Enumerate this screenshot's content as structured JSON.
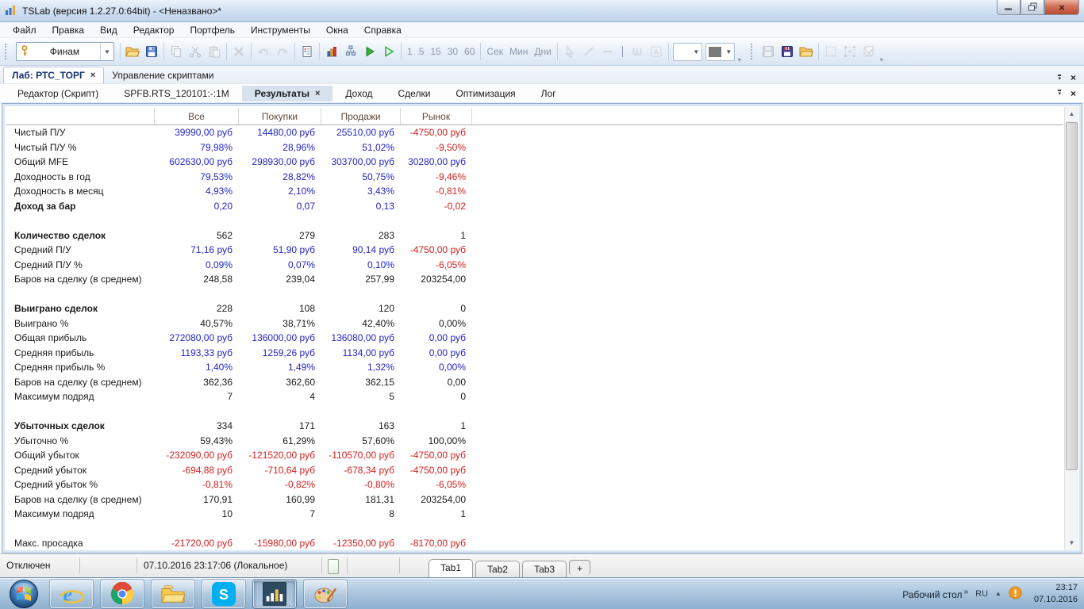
{
  "window": {
    "title": "TSLab (версия 1.2.27.0:64bit) - <Неназвано>*"
  },
  "menu": {
    "items": [
      "Файл",
      "Правка",
      "Вид",
      "Редактор",
      "Портфель",
      "Инструменты",
      "Окна",
      "Справка"
    ]
  },
  "toolbar": {
    "account_selector": "Финам",
    "timeframes": [
      "1",
      "5",
      "15",
      "30",
      "60"
    ],
    "periods": [
      "Сек",
      "Мин",
      "Дни"
    ]
  },
  "doc_tabs": [
    {
      "label": "Лаб: РТС_ТОРГ",
      "active": true,
      "closable": true
    },
    {
      "label": "Управление скриптами",
      "active": false,
      "closable": false
    }
  ],
  "view_tabs": [
    {
      "label": "Редактор (Скрипт)",
      "active": false,
      "closable": false
    },
    {
      "label": "SPFB.RTS_120101:-:1M",
      "active": false,
      "closable": false
    },
    {
      "label": "Результаты",
      "active": true,
      "closable": true
    },
    {
      "label": "Доход",
      "active": false,
      "closable": false
    },
    {
      "label": "Сделки",
      "active": false,
      "closable": false
    },
    {
      "label": "Оптимизация",
      "active": false,
      "closable": false
    },
    {
      "label": "Лог",
      "active": false,
      "closable": false
    }
  ],
  "results_table": {
    "columns": [
      "Все",
      "Покупки",
      "Продажи",
      "Рынок"
    ],
    "rows": [
      {
        "label": "Чистый П/У",
        "bold": false,
        "cells": [
          {
            "t": "39990,00 руб",
            "c": "pos"
          },
          {
            "t": "14480,00 руб",
            "c": "pos"
          },
          {
            "t": "25510,00 руб",
            "c": "pos"
          },
          {
            "t": "-4750,00 руб",
            "c": "neg"
          }
        ]
      },
      {
        "label": "Чистый П/У %",
        "bold": false,
        "cells": [
          {
            "t": "79,98%",
            "c": "pos"
          },
          {
            "t": "28,96%",
            "c": "pos"
          },
          {
            "t": "51,02%",
            "c": "pos"
          },
          {
            "t": "-9,50%",
            "c": "neg"
          }
        ]
      },
      {
        "label": "Общий MFE",
        "bold": false,
        "cells": [
          {
            "t": "602630,00 руб",
            "c": "pos"
          },
          {
            "t": "298930,00 руб",
            "c": "pos"
          },
          {
            "t": "303700,00 руб",
            "c": "pos"
          },
          {
            "t": "30280,00 руб",
            "c": "pos"
          }
        ]
      },
      {
        "label": "Доходность в год",
        "bold": false,
        "cells": [
          {
            "t": "79,53%",
            "c": "pos"
          },
          {
            "t": "28,82%",
            "c": "pos"
          },
          {
            "t": "50,75%",
            "c": "pos"
          },
          {
            "t": "-9,46%",
            "c": "neg"
          }
        ]
      },
      {
        "label": "Доходность в месяц",
        "bold": false,
        "cells": [
          {
            "t": "4,93%",
            "c": "pos"
          },
          {
            "t": "2,10%",
            "c": "pos"
          },
          {
            "t": "3,43%",
            "c": "pos"
          },
          {
            "t": "-0,81%",
            "c": "neg"
          }
        ]
      },
      {
        "label": "Доход за бар",
        "bold": true,
        "cells": [
          {
            "t": "0,20",
            "c": "pos"
          },
          {
            "t": "0,07",
            "c": "pos"
          },
          {
            "t": "0,13",
            "c": "pos"
          },
          {
            "t": "-0,02",
            "c": "neg"
          }
        ]
      },
      {
        "spacer": true
      },
      {
        "label": "Количество сделок",
        "bold": true,
        "cells": [
          {
            "t": "562",
            "c": "neu"
          },
          {
            "t": "279",
            "c": "neu"
          },
          {
            "t": "283",
            "c": "neu"
          },
          {
            "t": "1",
            "c": "neu"
          }
        ]
      },
      {
        "label": "Средний П/У",
        "bold": false,
        "cells": [
          {
            "t": "71,16 руб",
            "c": "pos"
          },
          {
            "t": "51,90 руб",
            "c": "pos"
          },
          {
            "t": "90,14 руб",
            "c": "pos"
          },
          {
            "t": "-4750,00 руб",
            "c": "neg"
          }
        ]
      },
      {
        "label": "Средний П/У %",
        "bold": false,
        "cells": [
          {
            "t": "0,09%",
            "c": "pos"
          },
          {
            "t": "0,07%",
            "c": "pos"
          },
          {
            "t": "0,10%",
            "c": "pos"
          },
          {
            "t": "-6,05%",
            "c": "neg"
          }
        ]
      },
      {
        "label": "Баров на сделку (в среднем)",
        "bold": false,
        "cells": [
          {
            "t": "248,58",
            "c": "neu"
          },
          {
            "t": "239,04",
            "c": "neu"
          },
          {
            "t": "257,99",
            "c": "neu"
          },
          {
            "t": "203254,00",
            "c": "neu"
          }
        ]
      },
      {
        "spacer": true
      },
      {
        "label": "Выиграно сделок",
        "bold": true,
        "cells": [
          {
            "t": "228",
            "c": "neu"
          },
          {
            "t": "108",
            "c": "neu"
          },
          {
            "t": "120",
            "c": "neu"
          },
          {
            "t": "0",
            "c": "neu"
          }
        ]
      },
      {
        "label": "Выиграно %",
        "bold": false,
        "cells": [
          {
            "t": "40,57%",
            "c": "neu"
          },
          {
            "t": "38,71%",
            "c": "neu"
          },
          {
            "t": "42,40%",
            "c": "neu"
          },
          {
            "t": "0,00%",
            "c": "neu"
          }
        ]
      },
      {
        "label": "Общая прибыль",
        "bold": false,
        "cells": [
          {
            "t": "272080,00 руб",
            "c": "pos"
          },
          {
            "t": "136000,00 руб",
            "c": "pos"
          },
          {
            "t": "136080,00 руб",
            "c": "pos"
          },
          {
            "t": "0,00 руб",
            "c": "pos"
          }
        ]
      },
      {
        "label": "Средняя прибыль",
        "bold": false,
        "cells": [
          {
            "t": "1193,33 руб",
            "c": "pos"
          },
          {
            "t": "1259,26 руб",
            "c": "pos"
          },
          {
            "t": "1134,00 руб",
            "c": "pos"
          },
          {
            "t": "0,00 руб",
            "c": "pos"
          }
        ]
      },
      {
        "label": "Средняя прибыль %",
        "bold": false,
        "cells": [
          {
            "t": "1,40%",
            "c": "pos"
          },
          {
            "t": "1,49%",
            "c": "pos"
          },
          {
            "t": "1,32%",
            "c": "pos"
          },
          {
            "t": "0,00%",
            "c": "pos"
          }
        ]
      },
      {
        "label": "Баров на сделку (в среднем)",
        "bold": false,
        "cells": [
          {
            "t": "362,36",
            "c": "neu"
          },
          {
            "t": "362,60",
            "c": "neu"
          },
          {
            "t": "362,15",
            "c": "neu"
          },
          {
            "t": "0,00",
            "c": "neu"
          }
        ]
      },
      {
        "label": "Максимум подряд",
        "bold": false,
        "cells": [
          {
            "t": "7",
            "c": "neu"
          },
          {
            "t": "4",
            "c": "neu"
          },
          {
            "t": "5",
            "c": "neu"
          },
          {
            "t": "0",
            "c": "neu"
          }
        ]
      },
      {
        "spacer": true
      },
      {
        "label": "Убыточных сделок",
        "bold": true,
        "cells": [
          {
            "t": "334",
            "c": "neu"
          },
          {
            "t": "171",
            "c": "neu"
          },
          {
            "t": "163",
            "c": "neu"
          },
          {
            "t": "1",
            "c": "neu"
          }
        ]
      },
      {
        "label": "Убыточно %",
        "bold": false,
        "cells": [
          {
            "t": "59,43%",
            "c": "neu"
          },
          {
            "t": "61,29%",
            "c": "neu"
          },
          {
            "t": "57,60%",
            "c": "neu"
          },
          {
            "t": "100,00%",
            "c": "neu"
          }
        ]
      },
      {
        "label": "Общий убыток",
        "bold": false,
        "cells": [
          {
            "t": "-232090,00 руб",
            "c": "neg"
          },
          {
            "t": "-121520,00 руб",
            "c": "neg"
          },
          {
            "t": "-110570,00 руб",
            "c": "neg"
          },
          {
            "t": "-4750,00 руб",
            "c": "neg"
          }
        ]
      },
      {
        "label": "Средний убыток",
        "bold": false,
        "cells": [
          {
            "t": "-694,88 руб",
            "c": "neg"
          },
          {
            "t": "-710,64 руб",
            "c": "neg"
          },
          {
            "t": "-678,34 руб",
            "c": "neg"
          },
          {
            "t": "-4750,00 руб",
            "c": "neg"
          }
        ]
      },
      {
        "label": "Средний убыток %",
        "bold": false,
        "cells": [
          {
            "t": "-0,81%",
            "c": "neg"
          },
          {
            "t": "-0,82%",
            "c": "neg"
          },
          {
            "t": "-0,80%",
            "c": "neg"
          },
          {
            "t": "-6,05%",
            "c": "neg"
          }
        ]
      },
      {
        "label": "Баров на сделку (в среднем)",
        "bold": false,
        "cells": [
          {
            "t": "170,91",
            "c": "neu"
          },
          {
            "t": "160,99",
            "c": "neu"
          },
          {
            "t": "181,31",
            "c": "neu"
          },
          {
            "t": "203254,00",
            "c": "neu"
          }
        ]
      },
      {
        "label": "Максимум подряд",
        "bold": false,
        "cells": [
          {
            "t": "10",
            "c": "neu"
          },
          {
            "t": "7",
            "c": "neu"
          },
          {
            "t": "8",
            "c": "neu"
          },
          {
            "t": "1",
            "c": "neu"
          }
        ]
      },
      {
        "spacer": true
      },
      {
        "label": "Макс. просадка",
        "bold": false,
        "cells": [
          {
            "t": "-21720,00 руб",
            "c": "neg"
          },
          {
            "t": "-15980,00 руб",
            "c": "neg"
          },
          {
            "t": "-12350,00 руб",
            "c": "neg"
          },
          {
            "t": "-8170,00 руб",
            "c": "neg"
          }
        ]
      }
    ]
  },
  "status_bar": {
    "connection_status": "Отключен",
    "datetime": "07.10.2016 23:17:06 (Локальное)",
    "tabs": [
      {
        "label": "Tab1",
        "active": true
      },
      {
        "label": "Tab2",
        "active": false
      },
      {
        "label": "Tab3",
        "active": false
      }
    ],
    "add_tab_label": "+"
  },
  "taskbar": {
    "desktop_toolbar_label": "Рабочий стол",
    "chevron": "»",
    "language": "RU",
    "time": "23:17",
    "date": "07.10.2016"
  },
  "colors": {
    "value_positive": "#2424c4",
    "value_negative": "#d32020",
    "value_neutral": "#1a1a1a",
    "header_text": "#5d4a39"
  }
}
